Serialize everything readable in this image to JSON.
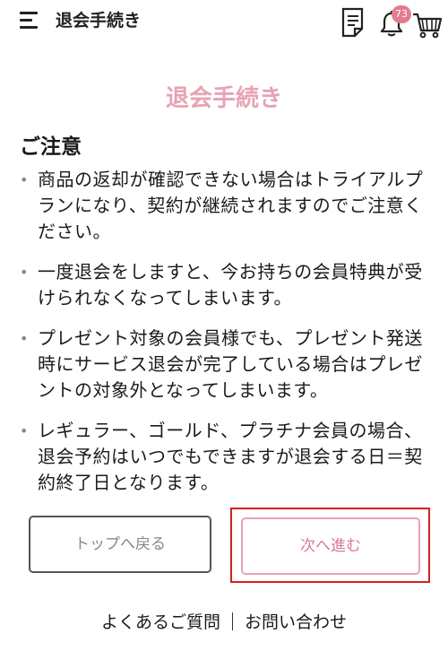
{
  "header": {
    "title": "退会手続き",
    "notification_count": "73",
    "icons": [
      "menu-icon",
      "document-icon",
      "bell-icon",
      "cart-icon"
    ]
  },
  "main": {
    "page_title": "退会手続き",
    "notice_heading": "ご注意",
    "bullet": "•",
    "notes": [
      "商品の返却が確認できない場合はトライアルプランになり、契約が継続されますのでご注意ください。",
      "一度退会をしますと、今お持ちの会員特典が受けられなくなってしまいます。",
      "プレゼント対象の会員様でも、プレゼント発送時にサービス退会が完了している場合はプレゼントの対象外となってしまいます。",
      "レギュラー、ゴールド、プラチナ会員の場合、退会予約はいつでもできますが退会する日＝契約終了日となります。"
    ]
  },
  "buttons": {
    "back_label": "トップへ戻る",
    "next_label": "次へ進む"
  },
  "footer": {
    "faq_label": "よくあるご質問",
    "contact_label": "お問い合わせ"
  },
  "colors": {
    "accent_pink": "#e8a2b3",
    "badge_pink": "#e57a92",
    "highlight_red": "#d81e1e"
  }
}
